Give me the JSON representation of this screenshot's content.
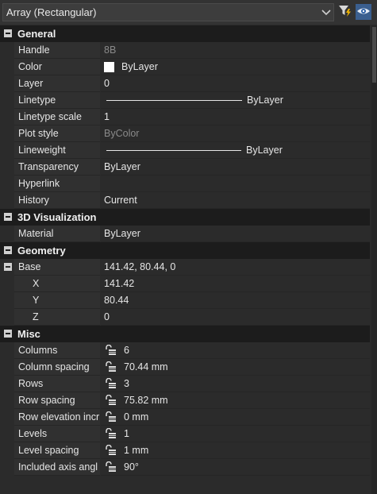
{
  "selector": {
    "value": "Array (Rectangular)"
  },
  "toolbar": {
    "quick_select_icon": "funnel-lightning-icon",
    "toggle_pickadd_icon": "eye-icon"
  },
  "colors": {
    "background": "#2b2b2b",
    "category_bg": "#1c1c1c",
    "accent": "#f0b400",
    "eye_blue": "#4a90d9"
  },
  "categories": {
    "general": {
      "label": "General",
      "props": [
        {
          "name": "Handle",
          "value": "8B",
          "dim": true
        },
        {
          "name": "Color",
          "value": "ByLayer"
        },
        {
          "name": "Layer",
          "value": "0"
        },
        {
          "name": "Linetype",
          "value": "ByLayer"
        },
        {
          "name": "Linetype scale",
          "value": "1"
        },
        {
          "name": "Plot style",
          "value": "ByColor",
          "dim": true
        },
        {
          "name": "Lineweight",
          "value": "ByLayer"
        },
        {
          "name": "Transparency",
          "value": "ByLayer"
        },
        {
          "name": "Hyperlink",
          "value": ""
        },
        {
          "name": "History",
          "value": "Current"
        }
      ]
    },
    "viz": {
      "label": "3D Visualization",
      "props": [
        {
          "name": "Material",
          "value": "ByLayer"
        }
      ]
    },
    "geometry": {
      "label": "Geometry",
      "props": [
        {
          "name": "Base",
          "value": "141.42, 80.44, 0"
        },
        {
          "name": "X",
          "value": "141.42"
        },
        {
          "name": "Y",
          "value": "80.44"
        },
        {
          "name": "Z",
          "value": "0"
        }
      ]
    },
    "misc": {
      "label": "Misc",
      "props": [
        {
          "name": "Columns",
          "value": "6"
        },
        {
          "name": "Column spacing",
          "value": "70.44 mm"
        },
        {
          "name": "Rows",
          "value": "3"
        },
        {
          "name": "Row spacing",
          "value": "75.82 mm"
        },
        {
          "name": "Row elevation incr",
          "value": "0 mm"
        },
        {
          "name": "Levels",
          "value": "1"
        },
        {
          "name": "Level spacing",
          "value": "1 mm"
        },
        {
          "name": "Included axis angl",
          "value": "90°"
        }
      ]
    }
  }
}
